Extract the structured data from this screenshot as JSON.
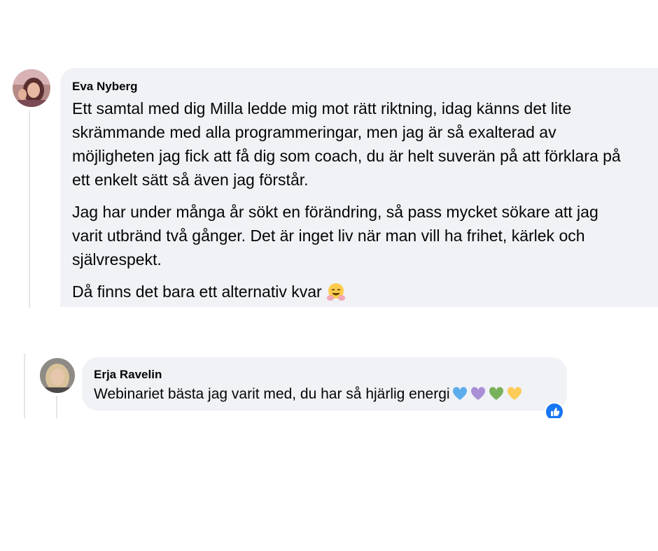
{
  "comments": [
    {
      "author": "Eva Nyberg",
      "paragraphs": [
        "Ett samtal med dig Milla ledde mig mot rätt riktning, idag känns det lite skrämmande med alla programmeringar, men jag är så exalterad av möjligheten jag fick att få dig som coach, du är helt suverän på att förklara på ett enkelt sätt så även jag förstår.",
        "Jag har under många år sökt en förändring, så pass mycket sökare att jag varit utbränd två gånger. Det är inget liv när man vill ha frihet, kärlek och självrespekt.",
        "Då finns det bara ett alternativ kvar"
      ],
      "emoji": "hugging-face-icon"
    },
    {
      "author": "Erja Ravelin",
      "text": "Webinariet bästa jag varit med, du har så hjärlig energi",
      "emojis": [
        "blue-heart-icon",
        "purple-heart-icon",
        "green-heart-icon",
        "yellow-heart-icon"
      ],
      "reaction": "like-icon"
    }
  ],
  "colors": {
    "bubble": "#f0f2f5",
    "like": "#1877f2",
    "thread_line": "#e4e6eb"
  }
}
